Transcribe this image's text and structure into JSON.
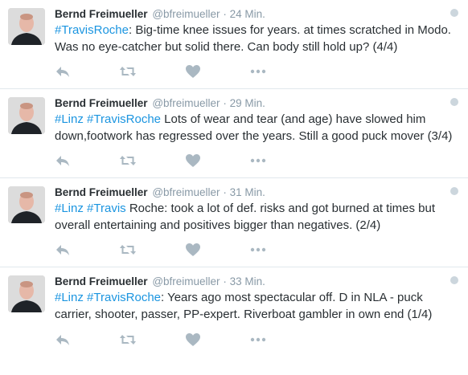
{
  "tweets": [
    {
      "name": "Bernd Freimueller",
      "handle": "@bfreimueller",
      "separator": "·",
      "time": "24 Min.",
      "segments": [
        {
          "text": "#TravisRoche",
          "tag": true
        },
        {
          "text": ": Big-time knee issues for years. at times scratched in Modo. Was no eye-catcher but solid there. Can body still hold up? (4/4)",
          "tag": false
        }
      ]
    },
    {
      "name": "Bernd Freimueller",
      "handle": "@bfreimueller",
      "separator": "·",
      "time": "29 Min.",
      "segments": [
        {
          "text": "#Linz",
          "tag": true
        },
        {
          "text": " ",
          "tag": false
        },
        {
          "text": "#TravisRoche",
          "tag": true
        },
        {
          "text": " Lots of wear and tear (and age) have slowed him down,footwork has regressed over the years. Still a good puck mover (3/4)",
          "tag": false
        }
      ]
    },
    {
      "name": "Bernd Freimueller",
      "handle": "@bfreimueller",
      "separator": "·",
      "time": "31 Min.",
      "segments": [
        {
          "text": "#Linz",
          "tag": true
        },
        {
          "text": " ",
          "tag": false
        },
        {
          "text": "#Travis",
          "tag": true
        },
        {
          "text": " Roche: took a lot of def. risks and got burned at times but overall entertaining and positives bigger than negatives. (2/4)",
          "tag": false
        }
      ]
    },
    {
      "name": "Bernd Freimueller",
      "handle": "@bfreimueller",
      "separator": "·",
      "time": "33 Min.",
      "segments": [
        {
          "text": "#Linz",
          "tag": true
        },
        {
          "text": " ",
          "tag": false
        },
        {
          "text": "#TravisRoche",
          "tag": true
        },
        {
          "text": ": Years ago most spectacular off. D in NLA - puck carrier, shooter, passer, PP-expert. Riverboat gambler in own end (1/4)",
          "tag": false
        }
      ]
    }
  ],
  "colors": {
    "hashtag": "#1b95e0",
    "meta": "#8899a6",
    "icon": "#aab8c2"
  },
  "icons": [
    "reply-icon",
    "retweet-icon",
    "like-icon",
    "more-icon"
  ]
}
